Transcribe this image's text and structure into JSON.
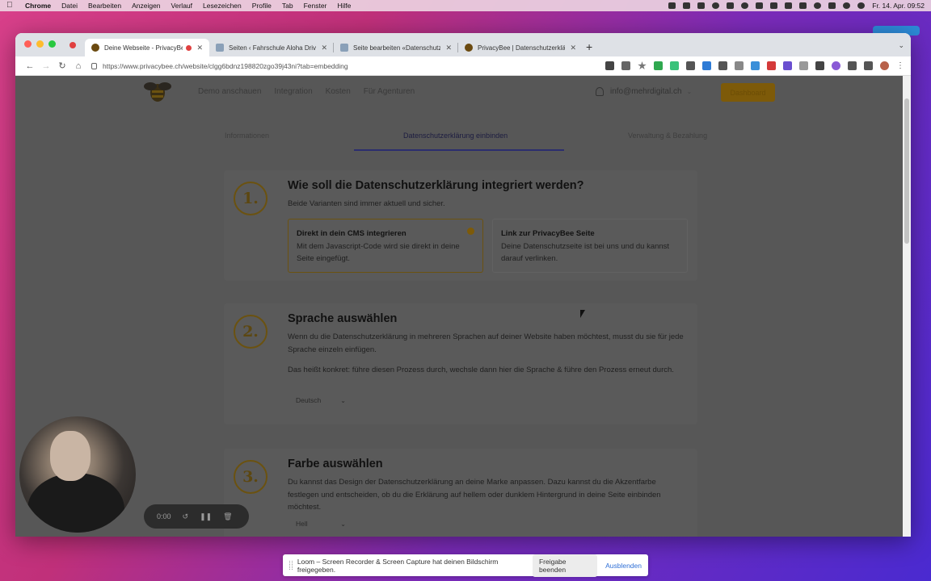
{
  "menubar": {
    "app": "Chrome",
    "items": [
      "Datei",
      "Bearbeiten",
      "Anzeigen",
      "Verlauf",
      "Lesezeichen",
      "Profile",
      "Tab",
      "Fenster",
      "Hilfe"
    ],
    "datetime": "Fr. 14. Apr. 09:52"
  },
  "browser": {
    "tabs": [
      {
        "title": "Deine Webseite - PrivacyBee",
        "active": true
      },
      {
        "title": "Seiten ‹ Fahrschule Aloha Drive",
        "active": false
      },
      {
        "title": "Seite bearbeiten «Datenschutzerk",
        "active": false
      },
      {
        "title": "PrivacyBee | Datenschutzerklärung",
        "active": false
      }
    ],
    "url": "https://www.privacybee.ch/website/clgg6bdnz198820zgo39j43ni?tab=embedding"
  },
  "site": {
    "nav": [
      "Demo anschauen",
      "Integration",
      "Kosten",
      "Für Agenturen"
    ],
    "user_email": "info@mehrdigital.ch",
    "dashboard_label": "Dashboard",
    "subtabs": [
      "Informationen",
      "Datenschutzerklärung einbinden",
      "Verwaltung & Bezahlung"
    ],
    "active_subtab": 1
  },
  "steps": {
    "s1": {
      "num": "1.",
      "title": "Wie soll die Datenschutzerklärung integriert werden?",
      "subtitle": "Beide Varianten sind immer aktuell und sicher.",
      "opt1_title": "Direkt in dein CMS integrieren",
      "opt1_text": "Mit dem Javascript-Code wird sie direkt in deine Seite eingefügt.",
      "opt2_title": "Link zur PrivacyBee Seite",
      "opt2_text": "Deine Datenschutzseite ist bei uns und du kannst darauf verlinken."
    },
    "s2": {
      "num": "2.",
      "title": "Sprache auswählen",
      "p1": "Wenn du die Datenschutzerklärung in mehreren Sprachen auf deiner Website haben möchtest, musst du sie für jede Sprache einzeln einfügen.",
      "p2": "Das heißt konkret: führe diesen Prozess durch, wechsle dann hier die Sprache & führe den Prozess erneut durch.",
      "select": "Deutsch"
    },
    "s3": {
      "num": "3.",
      "title": "Farbe auswählen",
      "p1": "Du kannst das Design der Datenschutzerklärung an deine Marke anpassen. Dazu kannst du die Akzentfarbe festlegen und entscheiden, ob du die Erklärung auf hellem oder dunklem Hintergrund in deine Seite einbinden möchtest.",
      "select": "Hell"
    }
  },
  "loom": {
    "timer": "0:00",
    "banner": "Loom – Screen Recorder & Screen Capture hat deinen Bildschirm freigegeben.",
    "stop_label": "Freigabe beenden",
    "hide_label": "Ausblenden"
  },
  "colors": {
    "accent": "#7d5a09",
    "nav_underline": "#2b2d6e",
    "overlay": "#575757"
  }
}
